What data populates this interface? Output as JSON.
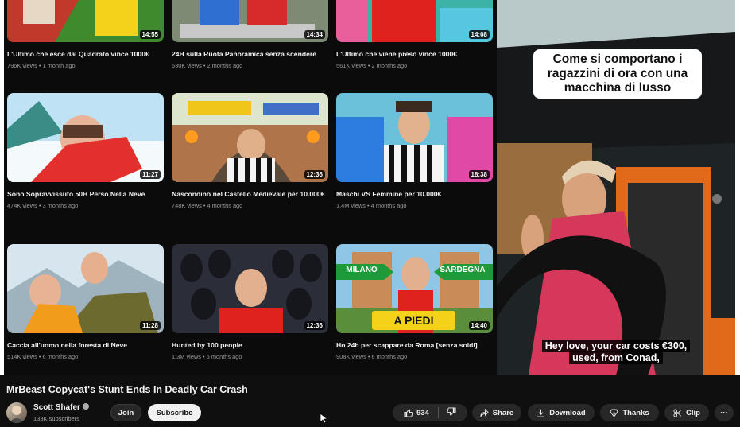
{
  "grid": {
    "cards": [
      {
        "title": "L'Ultimo che esce dal Quadrato vince 1000€",
        "meta": "796K views • 1 month ago",
        "duration": "14:55"
      },
      {
        "title": "24H sulla Ruota Panoramica senza scendere",
        "meta": "630K views • 2 months ago",
        "duration": "14:34"
      },
      {
        "title": "L'Ultimo che viene preso vince 1000€",
        "meta": "561K views • 2 months ago",
        "duration": "14:08"
      },
      {
        "title": "Sono Sopravvissuto 50H Perso Nella Neve",
        "meta": "474K views • 3 months ago",
        "duration": "11:27"
      },
      {
        "title": "Nascondino nel Castello Medievale per 10.000€",
        "meta": "748K views • 4 months ago",
        "duration": "12:36"
      },
      {
        "title": "Maschi VS Femmine per 10.000€",
        "meta": "1.4M views • 4 months ago",
        "duration": "18:38"
      },
      {
        "title": "Caccia all'uomo nella foresta di Neve",
        "meta": "514K views • 6 months ago",
        "duration": "11:28"
      },
      {
        "title": "Hunted by 100 people",
        "meta": "1.3M views • 6 months ago",
        "duration": "12:36"
      },
      {
        "title": "Ho 24h per scappare da Roma [senza soldi]",
        "meta": "908K views • 6 months ago",
        "duration": "14:40"
      }
    ],
    "thumb_text": {
      "milano": "MILANO",
      "sardegna": "SARDEGNA",
      "a_piedi": "A PIEDI"
    }
  },
  "short": {
    "caption_top": "Come si comportano i ragazzini di ora con una macchina di lusso",
    "caption_bottom_line1": "Hey love, your car costs €300,",
    "caption_bottom_line2": "used, from Conad,"
  },
  "video": {
    "title": "MrBeast Copycat's Stunt Ends In Deadly Car Crash",
    "channel": "Scott Shafer",
    "subscribers": "133K subscribers",
    "join_label": "Join",
    "subscribe_label": "Subscribe",
    "likes": "934",
    "share_label": "Share",
    "download_label": "Download",
    "thanks_label": "Thanks",
    "clip_label": "Clip",
    "more_label": "···"
  },
  "icons": [
    "thumbs-up-icon",
    "thumbs-down-icon",
    "share-icon",
    "download-icon",
    "thanks-icon",
    "clip-icon",
    "more-icon",
    "verified-icon",
    "cursor-icon"
  ]
}
